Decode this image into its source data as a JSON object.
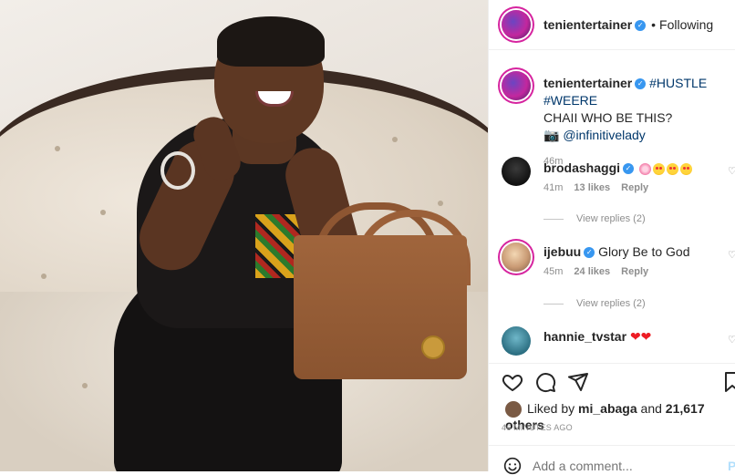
{
  "post": {
    "photo_alt": ""
  },
  "header": {
    "username": "tenientertainer",
    "separator": "•",
    "follow_status": "Following"
  },
  "caption": {
    "username": "tenientertainer",
    "hashtags": "#HUSTLE #WEERE",
    "text": "CHAII WHO BE THIS?",
    "camera_emoji": "📷",
    "mention": "@infinitivelady",
    "time": "46m"
  },
  "comments": [
    {
      "username": "brodashaggi",
      "text": "",
      "time": "41m",
      "likes": "13 likes",
      "reply": "Reply",
      "view_replies": "View replies (2)"
    },
    {
      "username": "ijebuu",
      "text": "Glory Be to God",
      "time": "45m",
      "likes": "24 likes",
      "reply": "Reply",
      "view_replies": "View replies (2)"
    },
    {
      "username": "hannie_tvstar",
      "text": "",
      "time": "",
      "likes": "",
      "reply": ""
    }
  ],
  "likes": {
    "prefix": "Liked by",
    "user": "mi_abaga",
    "suffix": "and",
    "count": "21,617 others"
  },
  "posted_ago": "46 MINUTES AGO",
  "add_comment": {
    "placeholder": "Add a comment...",
    "post_label": "P"
  },
  "icons": {
    "like": "heart-icon",
    "comment": "comment-icon",
    "share": "paper-plane-icon",
    "save": "bookmark-icon",
    "emoji": "smiley-icon",
    "verified": "verified-badge-icon"
  },
  "colors": {
    "link": "#00376b",
    "verified": "#3897f0",
    "secondary_text": "#8e8e8e",
    "divider": "#efefef"
  }
}
